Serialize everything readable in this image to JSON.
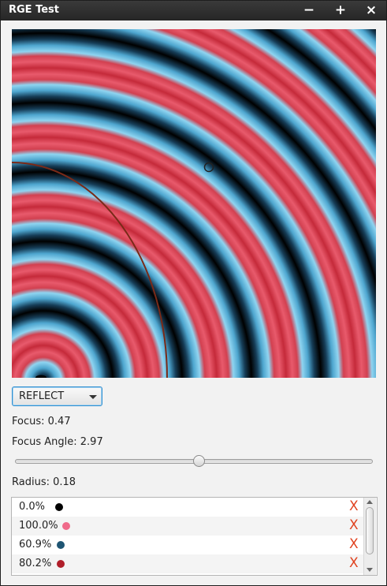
{
  "window": {
    "title": "RGE Test",
    "controls": {
      "minimize": "−",
      "maximize": "+",
      "close": "×"
    }
  },
  "canvas": {
    "gradient_colors": [
      "#000000",
      "#1a5a80",
      "#79c9ea",
      "#e23a4a",
      "#b11e2b",
      "#6ea9c8"
    ]
  },
  "cycle_method": {
    "selected": "REFLECT"
  },
  "focus": {
    "label": "Focus: 0.47"
  },
  "focus_angle": {
    "label": "Focus Angle: 2.97",
    "slider_value": 2.97,
    "slider_fraction": 0.515
  },
  "radius": {
    "label": "Radius: 0.18"
  },
  "stops": [
    {
      "offset": "0.0%",
      "color": "#000000",
      "delete": "X"
    },
    {
      "offset": "100.0%",
      "color": "#f06a8a",
      "delete": "X"
    },
    {
      "offset": "60.9%",
      "color": "#1f5573",
      "delete": "X"
    },
    {
      "offset": "80.2%",
      "color": "#b01e2a",
      "delete": "X"
    }
  ]
}
